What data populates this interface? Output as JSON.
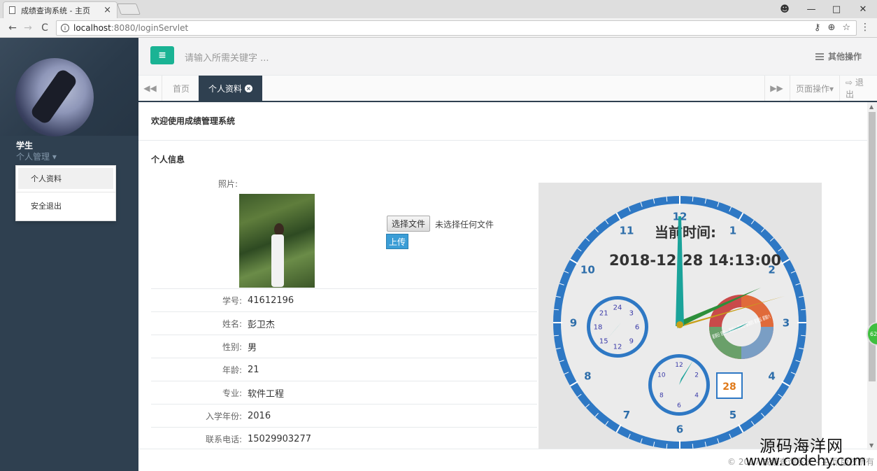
{
  "browser": {
    "tab_title": "成绩查询系统 - 主页",
    "tab_close": "×",
    "url_host": "localhost",
    "url_path": ":8080/loginServlet",
    "nav_back": "←",
    "nav_forward": "→",
    "nav_reload": "C",
    "win_account": "☻",
    "win_minimize": "—",
    "win_maximize": "□",
    "win_close": "✕"
  },
  "sidebar": {
    "user_name": "学生",
    "user_role": "个人管理 ▾",
    "menu": [
      {
        "label": "个人资料"
      },
      {
        "label": "安全退出"
      }
    ]
  },
  "header": {
    "menu_icon": "≡",
    "search_placeholder": "请输入所需关键字 ...",
    "other_ops": "其他操作"
  },
  "tabsbar": {
    "back_arrow": "◀◀",
    "forward_arrow": "▶▶",
    "tabs": [
      {
        "label": "首页"
      },
      {
        "label": "个人资料"
      }
    ],
    "page_ops": "页面操作▾",
    "logout": "⇨ 退出"
  },
  "content": {
    "welcome": "欢迎使用成绩管理系统",
    "section_title": "个人信息",
    "photo_label": "照片:",
    "file_button": "选择文件",
    "file_status": "未选择任何文件",
    "upload_button": "上传",
    "fields": [
      {
        "key": "学号:",
        "value": "41612196"
      },
      {
        "key": "姓名:",
        "value": "彭卫杰"
      },
      {
        "key": "性别:",
        "value": "男"
      },
      {
        "key": "年龄:",
        "value": "21"
      },
      {
        "key": "专业:",
        "value": "软件工程"
      },
      {
        "key": "入学年份:",
        "value": "2016"
      },
      {
        "key": "联系电话:",
        "value": "15029903277"
      }
    ]
  },
  "clock": {
    "title": "当前时间:",
    "datetime": "2018-12-28 14:13:00",
    "hours": [
      "12",
      "1",
      "2",
      "3",
      "4",
      "5",
      "6",
      "7",
      "8",
      "9",
      "10",
      "11"
    ],
    "sub24": [
      "24",
      "3",
      "6",
      "9",
      "12",
      "15",
      "18",
      "21"
    ],
    "sub12": [
      "12",
      "2",
      "4",
      "6",
      "8",
      "10"
    ],
    "weekdays": "星期日 星期一 星期二 星期三 星期四 星期五 星期六",
    "day": "28",
    "accent": "#2e78c4",
    "hand_color": "#1aa39a",
    "second_color": "#c8a01a"
  },
  "page": {
    "bubble": "62",
    "copyright": "© 2017 成绩查询系统 - 主页 版权所有",
    "watermark_cn": "源码海洋网",
    "watermark_en": "www.codehy.com"
  }
}
